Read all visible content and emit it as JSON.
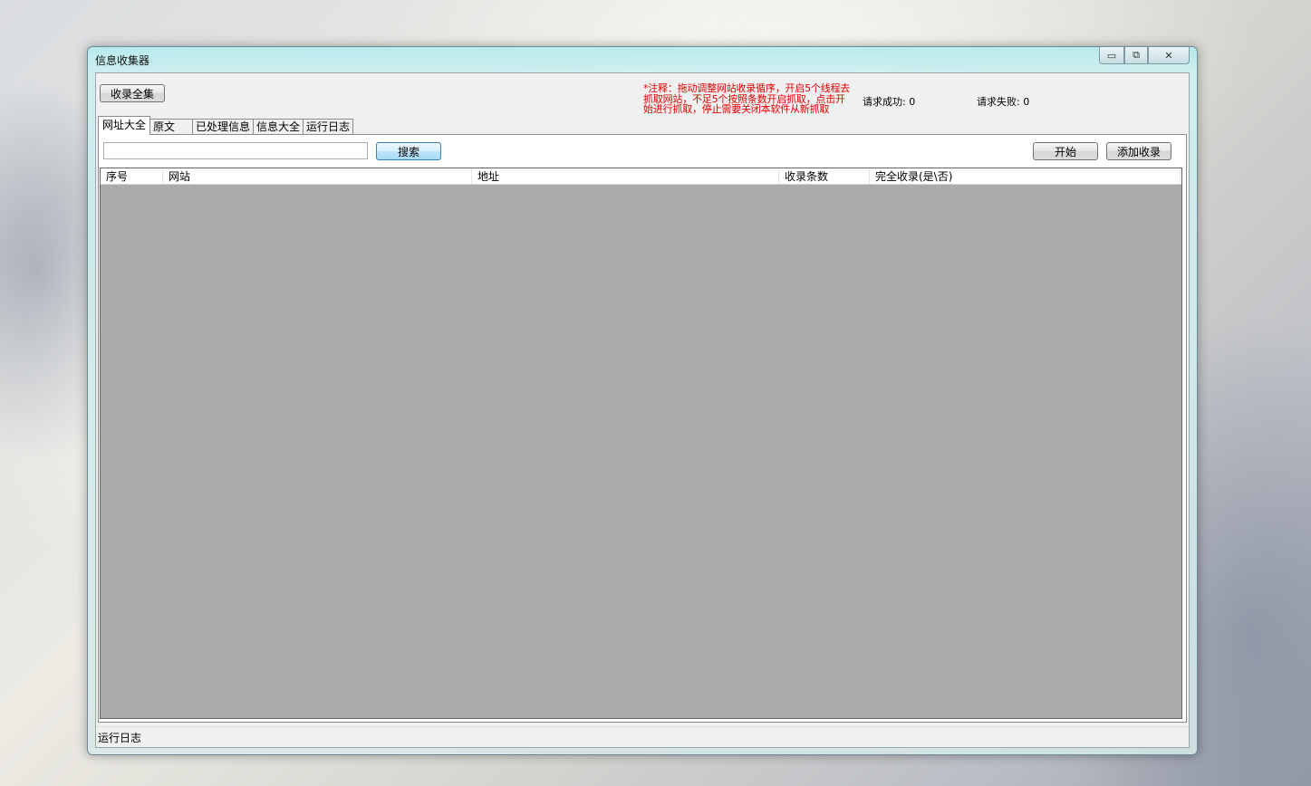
{
  "window": {
    "title": "信息收集器",
    "controls": {
      "minimize": "▭",
      "maximize": "⧉",
      "close": "✕"
    }
  },
  "toolbar": {
    "collect_all_label": "收录全集"
  },
  "note": "*注释：拖动调整网站收录循序，开启5个线程去抓取网站，不足5个按照条数开启抓取，点击开始进行抓取，停止需要关闭本软件从新抓取",
  "stats": {
    "success_label": "请求成功:",
    "success_value": "0",
    "fail_label": "请求失败:",
    "fail_value": "0"
  },
  "tabs": [
    {
      "label": "网址大全",
      "active": true
    },
    {
      "label": "原文"
    },
    {
      "label": "已处理信息"
    },
    {
      "label": "信息大全"
    },
    {
      "label": "运行日志"
    }
  ],
  "search": {
    "placeholder": "",
    "value": "",
    "button_label": "搜索"
  },
  "actions": {
    "start_label": "开始",
    "add_label": "添加收录"
  },
  "table": {
    "columns": [
      "序号",
      "网站",
      "地址",
      "收录条数",
      "完全收录(是\\否)"
    ],
    "rows": []
  },
  "statusbar": {
    "text": "运行日志"
  },
  "colors": {
    "note_red": "#e00000",
    "grid_empty": "#ababab",
    "title_glass": "#b4ebee"
  }
}
